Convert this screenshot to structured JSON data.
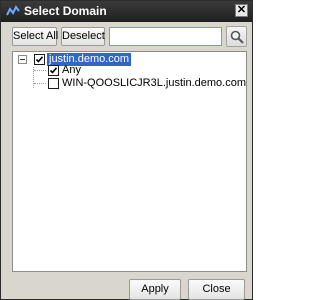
{
  "window": {
    "title": "Select Domain",
    "close_glyph": "✕"
  },
  "toolbar": {
    "select_all_label": "Select All",
    "deselect_label": "Deselect",
    "search_value": "",
    "search_icon": "magnifier-icon"
  },
  "tree": {
    "root": {
      "label": "justin.demo.com",
      "checked": true,
      "expanded": true,
      "selected": true
    },
    "children": [
      {
        "label": "Any",
        "checked": true
      },
      {
        "label": "WIN-QOOSLICJR3L.justin.demo.com",
        "checked": false
      }
    ]
  },
  "footer": {
    "apply_label": "Apply",
    "close_label": "Close"
  },
  "colors": {
    "title_bar": "#2b2b2b",
    "selection": "#3166c9",
    "window_bg": "#d8d6cd"
  }
}
